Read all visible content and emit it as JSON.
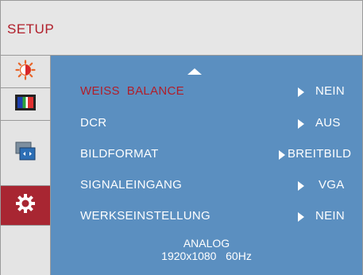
{
  "header": {
    "title": "SETUP"
  },
  "sidebar": {
    "items": [
      {
        "name": "brightness-icon",
        "active": false
      },
      {
        "name": "color-bars-icon",
        "active": false
      },
      {
        "name": "picture-format-icon",
        "active": false
      },
      {
        "name": "gear-icon",
        "active": true
      }
    ]
  },
  "menu": {
    "rows": [
      {
        "label": "WEISS  BALANCE",
        "value": "NEIN",
        "selected": true
      },
      {
        "label": "DCR",
        "value": "AUS",
        "selected": false
      },
      {
        "label": "BILDFORMAT",
        "value": "BREITBILD",
        "selected": false
      },
      {
        "label": "SIGNALEINGANG",
        "value": "VGA",
        "selected": false
      },
      {
        "label": "WERKSEINSTELLUNG",
        "value": "NEIN",
        "selected": false
      }
    ]
  },
  "footer": {
    "line1": "ANALOG",
    "line2": "1920x1080   60Hz"
  },
  "colors": {
    "accent": "#b01e2a",
    "panel": "#5b8fc0",
    "active_tab": "#a82632"
  }
}
